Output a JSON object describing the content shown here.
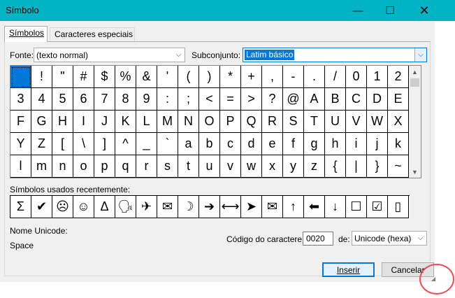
{
  "window": {
    "title": "Símbolo",
    "minimize_icon": "minimize-icon",
    "maximize_icon": "maximize-icon",
    "close_icon": "close-icon"
  },
  "tabs": [
    {
      "label": "Símbolos",
      "active": true
    },
    {
      "label": "Caracteres especiais",
      "active": false
    }
  ],
  "font": {
    "label": "Fonte:",
    "value": "(texto normal)"
  },
  "subset": {
    "label": "Subconjunto:",
    "value": "Latim básico"
  },
  "symbol_grid": {
    "rows": [
      [
        " ",
        "!",
        "\"",
        "#",
        "$",
        "%",
        "&",
        "'",
        "(",
        ")",
        "*",
        "+",
        ",",
        "-",
        ".",
        "/",
        "0",
        "1",
        "2"
      ],
      [
        "3",
        "4",
        "5",
        "6",
        "7",
        "8",
        "9",
        ":",
        ";",
        "<",
        "=",
        ">",
        "?",
        "@",
        "A",
        "B",
        "C",
        "D",
        "E"
      ],
      [
        "F",
        "G",
        "H",
        "I",
        "J",
        "K",
        "L",
        "M",
        "N",
        "O",
        "P",
        "Q",
        "R",
        "S",
        "T",
        "U",
        "V",
        "W",
        "X"
      ],
      [
        "Y",
        "Z",
        "[",
        "\\",
        "]",
        "^",
        "_",
        "`",
        "a",
        "b",
        "c",
        "d",
        "e",
        "f",
        "g",
        "h",
        "i",
        "j",
        "k"
      ],
      [
        "l",
        "m",
        "n",
        "o",
        "p",
        "q",
        "r",
        "s",
        "t",
        "u",
        "v",
        "w",
        "x",
        "y",
        "z",
        "{",
        "|",
        "}",
        "~"
      ]
    ],
    "selected_row": 0,
    "selected_col": 0
  },
  "recent": {
    "label": "Símbolos usados recentemente:",
    "symbols": [
      "Σ",
      "✔",
      "☹",
      "☺",
      "Δ",
      "🗣",
      "✈",
      "✉",
      "☽",
      "➔",
      "⟷",
      "➤",
      "✉",
      "↑",
      "⬅",
      "↓",
      "☐",
      "☑",
      "▯"
    ]
  },
  "unicode_name": {
    "label": "Nome Unicode:",
    "value": "Space"
  },
  "char_code": {
    "label": "Código do caractere:",
    "value": "0020"
  },
  "from": {
    "label": "de:",
    "value": "Unicode (hexa)"
  },
  "buttons": {
    "insert": "Inserir",
    "cancel": "Cancelar"
  },
  "colors": {
    "accent": "#0078d7",
    "titlebar": "#00b4c6",
    "highlight_circle": "#ec4b56"
  }
}
